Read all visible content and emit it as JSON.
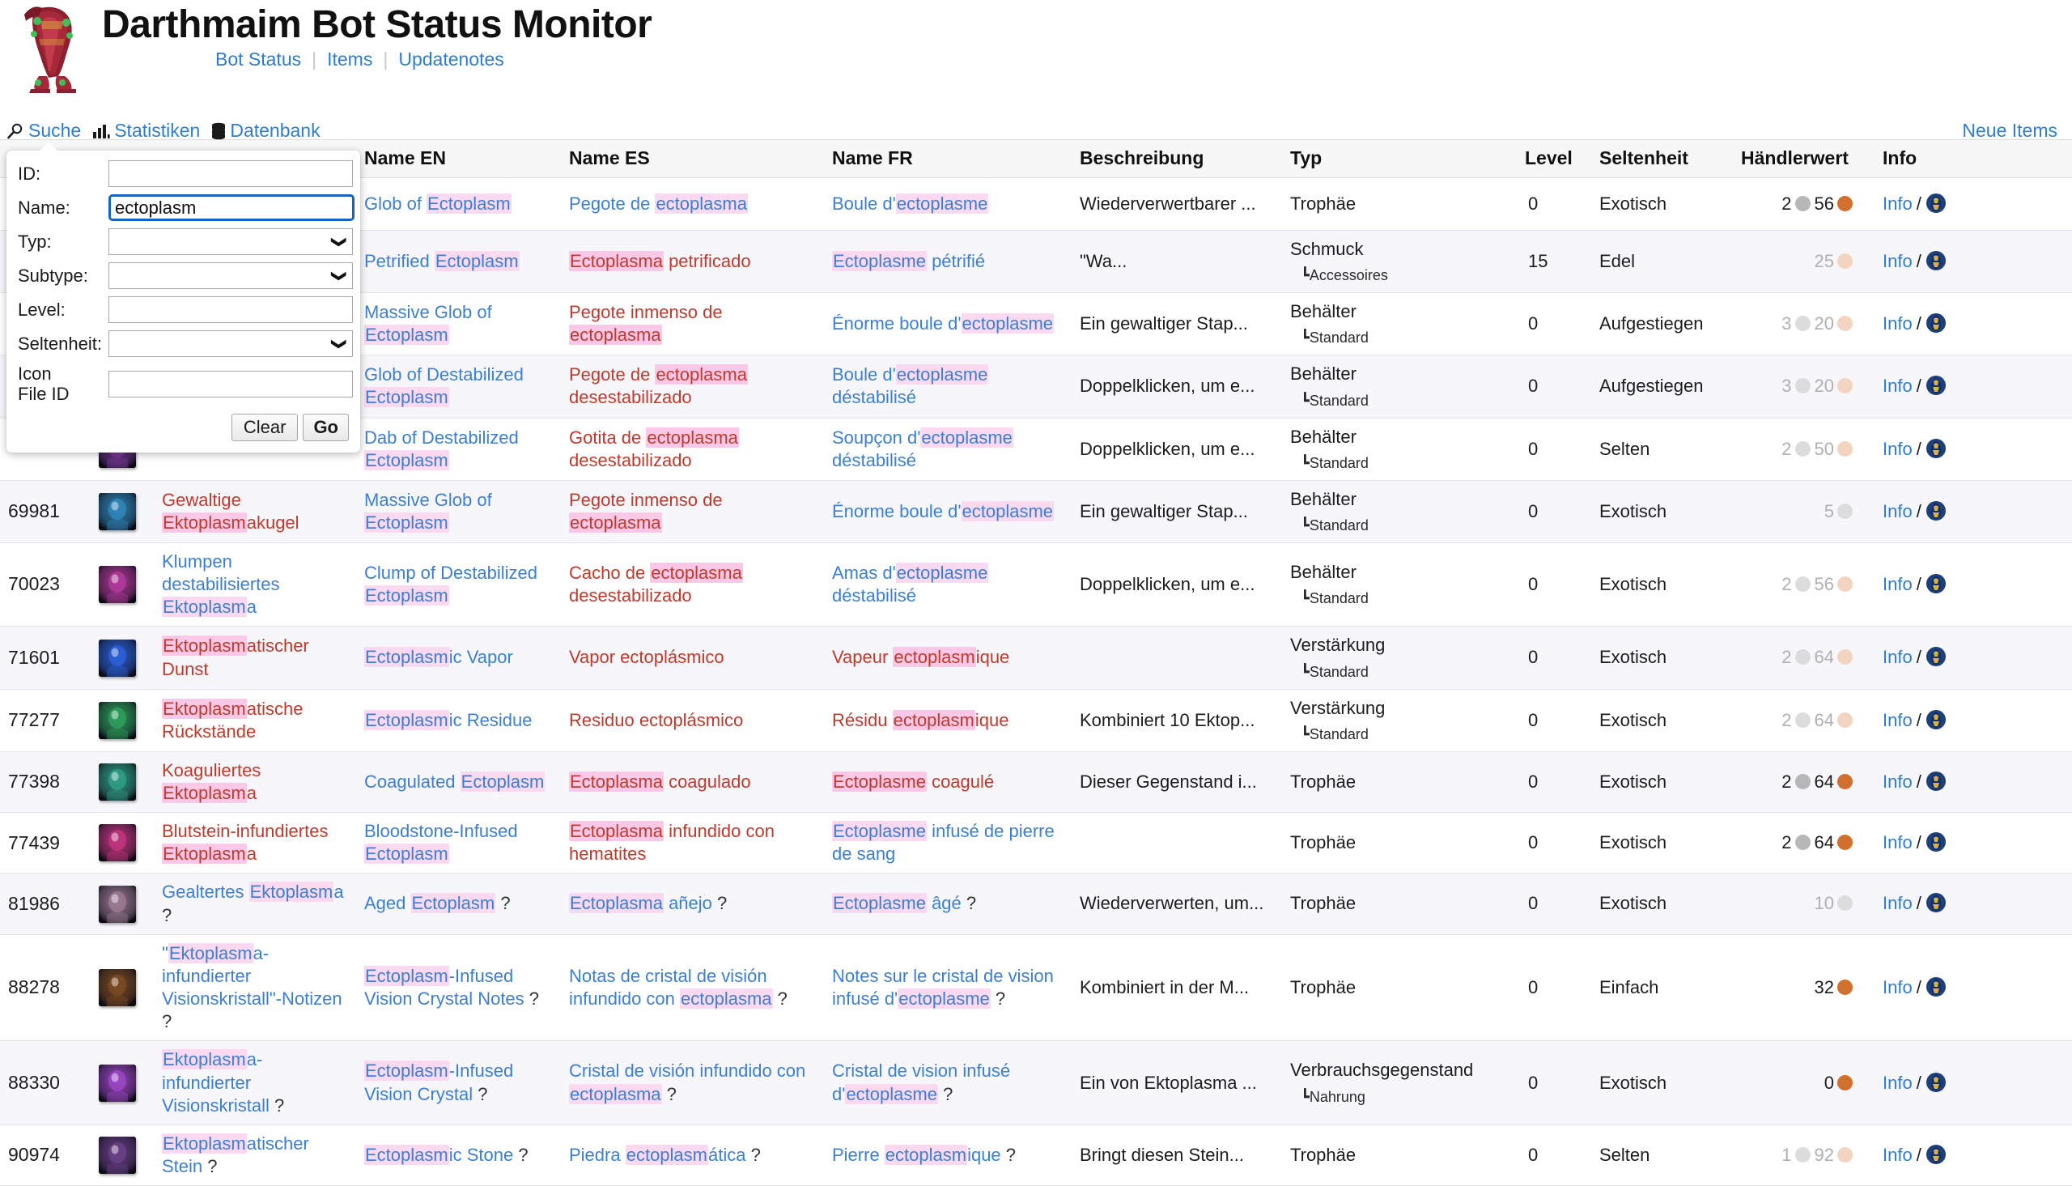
{
  "header": {
    "title": "Darthmaim Bot Status Monitor",
    "logo_name": "charr-logo",
    "nav": [
      {
        "label": "Bot Status"
      },
      {
        "label": "Items"
      },
      {
        "label": "Updatenotes"
      }
    ],
    "nav_separator": "|"
  },
  "toolbar": {
    "items": [
      {
        "label": "Suche",
        "icon": "magnifier-icon"
      },
      {
        "label": "Statistiken",
        "icon": "bar-chart-icon"
      },
      {
        "label": "Datenbank",
        "icon": "database-icon"
      }
    ],
    "new_items_label": "Neue Items"
  },
  "search_panel": {
    "fields": [
      {
        "label": "ID:",
        "type": "text",
        "value": "",
        "placeholder": "",
        "focused": false
      },
      {
        "label": "Name:",
        "type": "text",
        "value": "ectoplasm",
        "placeholder": "",
        "focused": true
      },
      {
        "label": "Typ:",
        "type": "select",
        "value": "",
        "placeholder": "",
        "focused": false
      },
      {
        "label": "Subtype:",
        "type": "select",
        "value": "",
        "placeholder": "",
        "focused": false
      },
      {
        "label": "Level:",
        "type": "text",
        "value": "",
        "placeholder": "",
        "focused": false
      },
      {
        "label": "Seltenheit:",
        "type": "select",
        "value": "",
        "placeholder": "",
        "focused": false
      },
      {
        "label": "Icon File ID",
        "type": "text",
        "value": "",
        "placeholder": "",
        "focused": false
      }
    ],
    "clear_label": "Clear",
    "go_label": "Go"
  },
  "table": {
    "columns": [
      "",
      "",
      "",
      "Name EN",
      "Name ES",
      "Name FR",
      "Beschreibung",
      "Typ",
      "Level",
      "Seltenheit",
      "Händlerwert",
      "Info"
    ],
    "info_label": "Info",
    "wowhead_icon": "wowhead-icon",
    "rows": [
      {
        "id": "",
        "icon_color": "#2b6f8f",
        "name_de": "",
        "name_de_red": false,
        "name_en": "Glob of Ectoplasm",
        "en_hl": "Ectoplasm",
        "en_red": false,
        "name_es": "Pegote de ectoplasma",
        "es_hl": "ectoplasma",
        "es_red": false,
        "name_fr": "Boule d'ectoplasme",
        "fr_hl": "ectoplasme",
        "fr_red": false,
        "desc": "Wiederverwertbarer ...",
        "typ": "Trophäe",
        "subtype": "",
        "level": "0",
        "rarity": "Exotisch",
        "value": [
          {
            "num": "2",
            "coin": "silver",
            "dim": false
          },
          {
            "num": "56",
            "coin": "copper",
            "dim": false
          }
        ]
      },
      {
        "id": "",
        "icon_color": "#8a2540",
        "name_de": "",
        "name_de_red": false,
        "name_en": "Petrified Ectoplasm",
        "en_hl": "Ectoplasm",
        "en_red": false,
        "name_es": "Ectoplasma petrificado",
        "es_hl": "Ectoplasma",
        "es_red": true,
        "name_fr": "Ectoplasme pétrifié",
        "fr_hl": "Ectoplasme",
        "fr_red": false,
        "desc": "\"Wa...",
        "typ": "Schmuck",
        "subtype": "┗Accessoires",
        "level": "15",
        "rarity": "Edel",
        "value": [
          {
            "num": "25",
            "coin": "copper",
            "dim": true
          }
        ]
      },
      {
        "id": "",
        "icon_color": "#3c7fa8",
        "name_de": "",
        "name_de_red": false,
        "name_en": "Massive Glob of Ectoplasm",
        "en_hl": "Ectoplasm",
        "en_red": false,
        "name_es": "Pegote inmenso de ectoplasma",
        "es_hl": "ectoplasma",
        "es_red": true,
        "name_fr": "Énorme boule d'ectoplasme",
        "fr_hl": "ectoplasme",
        "fr_red": false,
        "desc": "Ein gewaltiger Stap...",
        "typ": "Behälter",
        "subtype": "┗Standard",
        "level": "0",
        "rarity": "Aufgestiegen",
        "value": [
          {
            "num": "3",
            "coin": "silver",
            "dim": true
          },
          {
            "num": "20",
            "coin": "copper",
            "dim": true
          }
        ]
      },
      {
        "id": "",
        "icon_color": "#a0408c",
        "name_de": "",
        "name_de_red": false,
        "name_en": "Glob of Destabilized Ectoplasm",
        "en_hl": "Ectoplasm",
        "en_red": false,
        "name_es": "Pegote de ectoplasma desestabilizado",
        "es_hl": "ectoplasma",
        "es_red": true,
        "name_fr": "Boule d'ectoplasme déstabilisé",
        "fr_hl": "ectoplasme",
        "fr_red": false,
        "desc": "Doppelklicken, um e...",
        "typ": "Behälter",
        "subtype": "┗Standard",
        "level": "0",
        "rarity": "Aufgestiegen",
        "value": [
          {
            "num": "3",
            "coin": "silver",
            "dim": true
          },
          {
            "num": "20",
            "coin": "copper",
            "dim": true
          }
        ]
      },
      {
        "id": "",
        "icon_color": "#7a3c9c",
        "name_de": "",
        "name_de_red": false,
        "name_en": "Dab of Destabilized Ectoplasm",
        "en_hl": "Ectoplasm",
        "en_red": false,
        "name_es": "Gotita de ectoplasma desestabilizado",
        "es_hl": "ectoplasma",
        "es_red": true,
        "name_fr": "Soupçon d'ectoplasme déstabilisé",
        "fr_hl": "ectoplasme",
        "fr_red": false,
        "desc": "Doppelklicken, um e...",
        "typ": "Behälter",
        "subtype": "┗Standard",
        "level": "0",
        "rarity": "Selten",
        "value": [
          {
            "num": "2",
            "coin": "silver",
            "dim": true
          },
          {
            "num": "50",
            "coin": "copper",
            "dim": true
          }
        ]
      },
      {
        "id": "69981",
        "icon_color": "#2f86b8",
        "name_de": "Gewaltige Ektoplasmakugel",
        "name_de_red": true,
        "name_en": "Massive Glob of Ectoplasm",
        "en_hl": "Ectoplasm",
        "en_red": false,
        "name_es": "Pegote inmenso de ectoplasma",
        "es_hl": "ectoplasma",
        "es_red": true,
        "name_fr": "Énorme boule d'ectoplasme",
        "fr_hl": "ectoplasme",
        "fr_red": false,
        "desc": "Ein gewaltiger Stap...",
        "typ": "Behälter",
        "subtype": "┗Standard",
        "level": "0",
        "rarity": "Exotisch",
        "value": [
          {
            "num": "5",
            "coin": "silver",
            "dim": true
          }
        ]
      },
      {
        "id": "70023",
        "icon_color": "#b0399a",
        "name_de": "Klumpen destabilisiertes Ektoplasma",
        "name_de_red": false,
        "name_en": "Clump of Destabilized Ectoplasm",
        "en_hl": "Ectoplasm",
        "en_red": false,
        "name_es": "Cacho de ectoplasma desestabilizado",
        "es_hl": "ectoplasma",
        "es_red": true,
        "name_fr": "Amas d'ectoplasme déstabilisé",
        "fr_hl": "ectoplasme",
        "fr_red": false,
        "desc": "Doppelklicken, um e...",
        "typ": "Behälter",
        "subtype": "┗Standard",
        "level": "0",
        "rarity": "Exotisch",
        "value": [
          {
            "num": "2",
            "coin": "silver",
            "dim": true
          },
          {
            "num": "56",
            "coin": "copper",
            "dim": true
          }
        ]
      },
      {
        "id": "71601",
        "icon_color": "#2a5fd6",
        "name_de": "Ektoplasmatischer Dunst",
        "name_de_red": true,
        "name_en": "Ectoplasmic Vapor",
        "en_hl": "Ectoplasm",
        "en_red": false,
        "name_es": "Vapor ectoplásmico",
        "es_hl": "",
        "es_red": true,
        "name_fr": "Vapeur ectoplasmique",
        "fr_hl": "ectoplasm",
        "fr_red": true,
        "desc": "",
        "typ": "Verstärkung",
        "subtype": "┗Standard",
        "level": "0",
        "rarity": "Exotisch",
        "value": [
          {
            "num": "2",
            "coin": "silver",
            "dim": true
          },
          {
            "num": "64",
            "coin": "copper",
            "dim": true
          }
        ]
      },
      {
        "id": "77277",
        "icon_color": "#2e9e5b",
        "name_de": "Ektoplasmatische Rückstände",
        "name_de_red": true,
        "name_en": "Ectoplasmic Residue",
        "en_hl": "Ectoplasm",
        "en_red": false,
        "name_es": "Residuo ectoplásmico",
        "es_hl": "",
        "es_red": true,
        "name_fr": "Résidu ectoplasmique",
        "fr_hl": "ectoplasm",
        "fr_red": true,
        "desc": "Kombiniert 10 Ektop...",
        "typ": "Verstärkung",
        "subtype": "┗Standard",
        "level": "0",
        "rarity": "Exotisch",
        "value": [
          {
            "num": "2",
            "coin": "silver",
            "dim": true
          },
          {
            "num": "64",
            "coin": "copper",
            "dim": true
          }
        ]
      },
      {
        "id": "77398",
        "icon_color": "#2f9e86",
        "name_de": "Koaguliertes Ektoplasma",
        "name_de_red": true,
        "name_en": "Coagulated Ectoplasm",
        "en_hl": "Ectoplasm",
        "en_red": false,
        "name_es": "Ectoplasma coagulado",
        "es_hl": "Ectoplasma",
        "es_red": true,
        "name_fr": "Ectoplasme coagulé",
        "fr_hl": "Ectoplasme",
        "fr_red": true,
        "desc": "Dieser Gegenstand i...",
        "typ": "Trophäe",
        "subtype": "",
        "level": "0",
        "rarity": "Exotisch",
        "value": [
          {
            "num": "2",
            "coin": "silver",
            "dim": false
          },
          {
            "num": "64",
            "coin": "copper",
            "dim": false
          }
        ]
      },
      {
        "id": "77439",
        "icon_color": "#c0357e",
        "name_de": "Blutstein-infundiertes Ektoplasma",
        "name_de_red": true,
        "name_en": "Bloodstone-Infused Ectoplasm",
        "en_hl": "Ectoplasm",
        "en_red": false,
        "name_es": "Ectoplasma infundido con hematites",
        "es_hl": "Ectoplasma",
        "es_red": true,
        "name_fr": "Ectoplasme infusé de pierre de sang",
        "fr_hl": "Ectoplasme",
        "fr_red": false,
        "desc": "",
        "typ": "Trophäe",
        "subtype": "",
        "level": "0",
        "rarity": "Exotisch",
        "value": [
          {
            "num": "2",
            "coin": "silver",
            "dim": false
          },
          {
            "num": "64",
            "coin": "copper",
            "dim": false
          }
        ]
      },
      {
        "id": "81986",
        "icon_color": "#9b7a93",
        "name_de": "Gealtertes Ektoplasma ?",
        "name_de_red": false,
        "name_en": "Aged Ectoplasm ?",
        "en_hl": "Ectoplasm",
        "en_red": false,
        "name_es": "Ectoplasma añejo ?",
        "es_hl": "Ectoplasma",
        "es_red": false,
        "name_fr": "Ectoplasme âgé ?",
        "fr_hl": "Ectoplasme",
        "fr_red": false,
        "desc": "Wiederverwerten, um...",
        "typ": "Trophäe",
        "subtype": "",
        "level": "0",
        "rarity": "Exotisch",
        "value": [
          {
            "num": "10",
            "coin": "silver",
            "dim": true
          }
        ]
      },
      {
        "id": "88278",
        "icon_color": "#7a4a22",
        "name_de": "\"Ektoplasma-infundierter Visionskristall\"-Notizen ?",
        "name_de_red": false,
        "name_en": "Ectoplasm-Infused Vision Crystal Notes ?",
        "en_hl": "Ectoplasm",
        "en_red": false,
        "name_es": "Notas de cristal de visión infundido con ectoplasma ?",
        "es_hl": "ectoplasma",
        "es_red": false,
        "name_fr": "Notes sur le cristal de vision infusé d'ectoplasme ?",
        "fr_hl": "ectoplasme",
        "fr_red": false,
        "desc": "Kombiniert in der M...",
        "typ": "Trophäe",
        "subtype": "",
        "level": "0",
        "rarity": "Einfach",
        "value": [
          {
            "num": "32",
            "coin": "copper",
            "dim": false
          }
        ]
      },
      {
        "id": "88330",
        "icon_color": "#9b45c4",
        "name_de": "Ektoplasma-infundierter Visionskristall ?",
        "name_de_red": false,
        "name_en": "Ectoplasm-Infused Vision Crystal ?",
        "en_hl": "Ectoplasm",
        "en_red": false,
        "name_es": "Cristal de visión infundido con ectoplasma ?",
        "es_hl": "ectoplasma",
        "es_red": false,
        "name_fr": "Cristal de vision infusé d'ectoplasme ?",
        "fr_hl": "ectoplasme",
        "fr_red": false,
        "desc": "Ein von Ektoplasma ...",
        "typ": "Verbrauchsgegenstand",
        "subtype": "┗Nahrung",
        "level": "0",
        "rarity": "Exotisch",
        "value": [
          {
            "num": "0",
            "coin": "copper",
            "dim": false
          }
        ]
      },
      {
        "id": "90974",
        "icon_color": "#6a3f86",
        "name_de": "Ektoplasmatischer Stein ?",
        "name_de_red": false,
        "name_en": "Ectoplasmic Stone ?",
        "en_hl": "Ectoplasm",
        "en_red": false,
        "name_es": "Piedra ectoplasmática ?",
        "es_hl": "ectoplasm",
        "es_red": false,
        "name_fr": "Pierre ectoplasmique ?",
        "fr_hl": "ectoplasm",
        "fr_red": false,
        "desc": "Bringt diesen Stein...",
        "typ": "Trophäe",
        "subtype": "",
        "level": "0",
        "rarity": "Selten",
        "value": [
          {
            "num": "1",
            "coin": "silver",
            "dim": true
          },
          {
            "num": "92",
            "coin": "copper",
            "dim": true
          }
        ]
      }
    ]
  }
}
